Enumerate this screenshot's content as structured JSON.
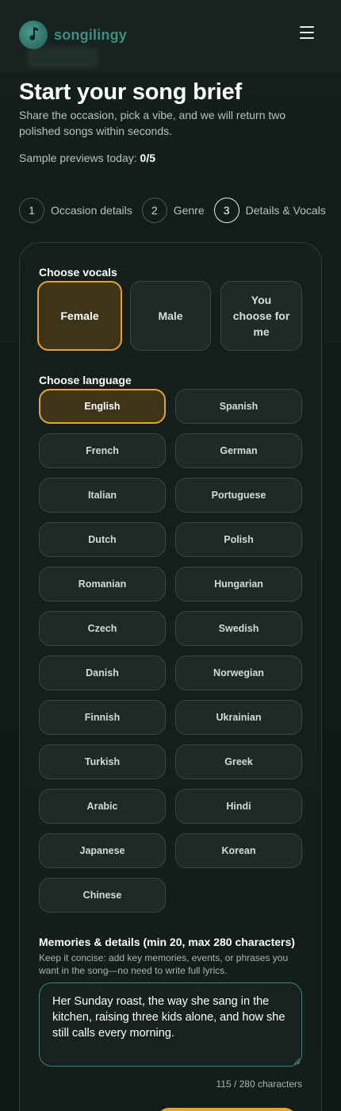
{
  "brand": {
    "name": "songilingy",
    "logo_icon": "music-note-icon",
    "menu_icon": "hamburger-menu-icon"
  },
  "hero": {
    "title": "Start your song brief",
    "subtitle": "Share the occasion, pick a vibe, and we will return two polished songs within seconds."
  },
  "sample": {
    "label": "Sample previews today:",
    "value": "0/5"
  },
  "steps": [
    {
      "num": "1",
      "label": "Occasion details"
    },
    {
      "num": "2",
      "label": "Genre"
    },
    {
      "num": "3",
      "label": "Details & Vocals"
    }
  ],
  "vocals": {
    "title": "Choose vocals",
    "options": [
      "Female",
      "Male",
      "You choose for me"
    ],
    "selected": "Female"
  },
  "language": {
    "title": "Choose language",
    "options": [
      "English",
      "Spanish",
      "French",
      "German",
      "Italian",
      "Portuguese",
      "Dutch",
      "Polish",
      "Romanian",
      "Hungarian",
      "Czech",
      "Swedish",
      "Danish",
      "Norwegian",
      "Finnish",
      "Ukrainian",
      "Turkish",
      "Greek",
      "Arabic",
      "Hindi",
      "Japanese",
      "Korean",
      "Chinese"
    ],
    "selected": "English"
  },
  "memories": {
    "title": "Memories & details (min 20, max 280 characters)",
    "hint": "Keep it concise: add key memories, events, or phrases you want in the song—no need to write full lyrics.",
    "value": "Her Sunday roast, the way she sang in the kitchen, raising three kids alone, and how she still calls every morning.",
    "count": "115 / 280 characters"
  },
  "colors": {
    "accent": "#e6a42a",
    "brand": "#3f8d80",
    "selected_bg": "#3d3419"
  }
}
